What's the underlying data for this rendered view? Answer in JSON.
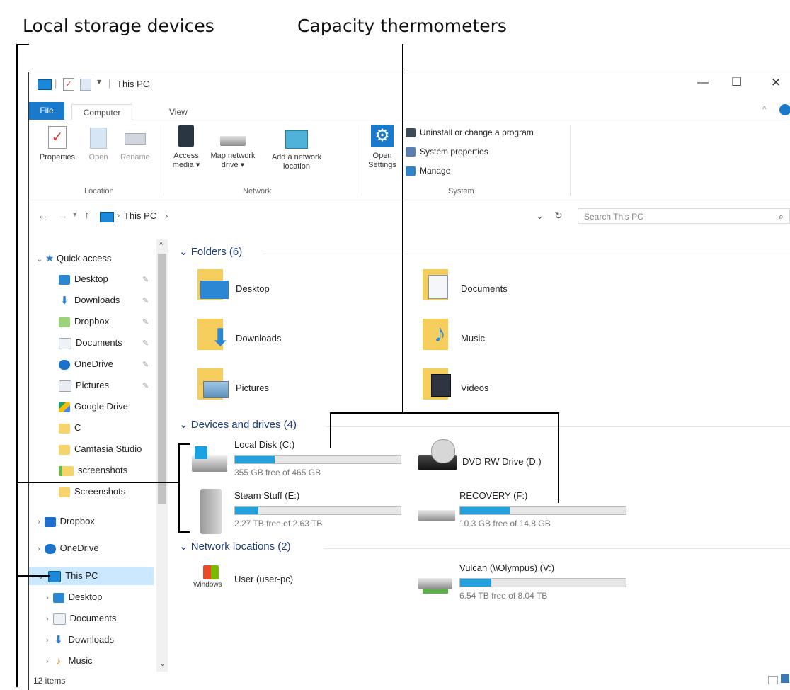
{
  "callouts": {
    "local_storage": "Local storage devices",
    "capacity": "Capacity thermometers"
  },
  "window": {
    "title": "This PC",
    "tabs": {
      "file": "File",
      "computer": "Computer",
      "view": "View"
    },
    "controls": {
      "minimize": "—",
      "maximize": "☐",
      "close": "✕"
    }
  },
  "ribbon": {
    "location": {
      "label": "Location",
      "properties": "Properties",
      "open": "Open",
      "rename": "Rename"
    },
    "network": {
      "label": "Network",
      "access_media_1": "Access",
      "access_media_2": "media ▾",
      "map_drive_1": "Map network",
      "map_drive_2": "drive ▾",
      "add_loc_1": "Add a network",
      "add_loc_2": "location"
    },
    "open_settings_1": "Open",
    "open_settings_2": "Settings",
    "system": {
      "label": "System",
      "uninstall": "Uninstall or change a program",
      "sys_props": "System properties",
      "manage": "Manage"
    }
  },
  "address": {
    "path": "This PC",
    "sep": "›",
    "search_placeholder": "Search This PC"
  },
  "nav": {
    "quick_access": "Quick access",
    "quick_items": [
      "Desktop",
      "Downloads",
      "Dropbox",
      "Documents",
      "OneDrive",
      "Pictures",
      "Google Drive",
      "C",
      "Camtasia Studio",
      "screenshots",
      "Screenshots"
    ],
    "dropbox": "Dropbox",
    "onedrive": "OneDrive",
    "this_pc": "This PC",
    "pc_items": [
      "Desktop",
      "Documents",
      "Downloads",
      "Music"
    ]
  },
  "sections": {
    "folders": "Folders (6)",
    "devices": "Devices and drives (4)",
    "network": "Network locations (2)"
  },
  "folders": [
    "Desktop",
    "Documents",
    "Downloads",
    "Music",
    "Pictures",
    "Videos"
  ],
  "drives": [
    {
      "name": "Local Disk (C:)",
      "free": "355 GB free of 465 GB",
      "used_fraction": 0.24
    },
    {
      "name": "DVD RW Drive (D:)"
    },
    {
      "name": "Steam Stuff (E:)",
      "free": "2.27 TB free of 2.63 TB",
      "used_fraction": 0.14
    },
    {
      "name": "RECOVERY (F:)",
      "free": "10.3 GB free of 14.8 GB",
      "used_fraction": 0.3
    }
  ],
  "network_locations": [
    {
      "name": "User (user-pc)",
      "logo": "Windows"
    },
    {
      "name": "Vulcan (\\\\Olympus) (V:)",
      "free": "6.54 TB free of 8.04 TB",
      "used_fraction": 0.19
    }
  ],
  "status": {
    "items": "12 items"
  },
  "colors": {
    "accent": "#1979ca",
    "bar": "#26a0da",
    "selected": "#cce8ff"
  }
}
